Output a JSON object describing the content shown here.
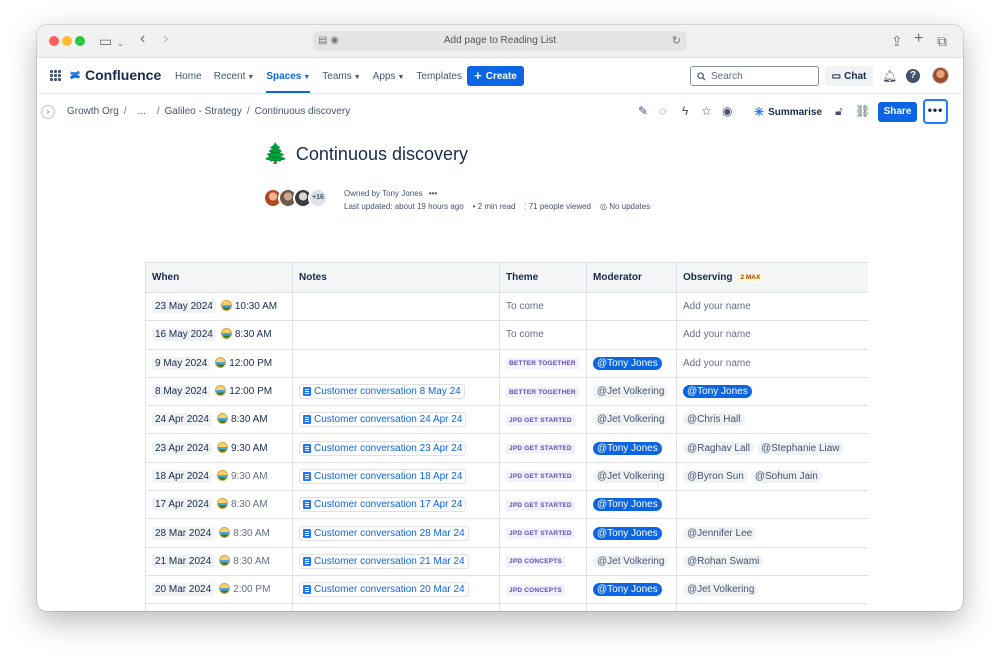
{
  "browser": {
    "address_text": "Add page to Reading List"
  },
  "header": {
    "product_name": "Confluence",
    "nav": [
      {
        "label": "Home",
        "dropdown": false
      },
      {
        "label": "Recent",
        "dropdown": true
      },
      {
        "label": "Spaces",
        "dropdown": true,
        "active": true
      },
      {
        "label": "Teams",
        "dropdown": true
      },
      {
        "label": "Apps",
        "dropdown": true
      },
      {
        "label": "Templates",
        "dropdown": false
      }
    ],
    "create_label": "Create",
    "search_placeholder": "Search",
    "chat_label": "Chat",
    "help_glyph": "?"
  },
  "pagebar": {
    "breadcrumbs": [
      "Growth Org",
      "...",
      "Galileo - Strategy",
      "Continuous discovery"
    ],
    "summarise_label": "Summarise",
    "share_label": "Share",
    "more_glyph": "•••"
  },
  "page": {
    "emoji": "🌲",
    "title": "Continuous discovery",
    "contributors_more": "+16",
    "owned_by": "Owned by Tony Jones",
    "last_updated": "Last updated: about 19 hours ago",
    "read_time": "2 min read",
    "views": "71 people viewed",
    "updates": "No updates"
  },
  "table": {
    "headers": {
      "when": "When",
      "notes": "Notes",
      "theme": "Theme",
      "moderator": "Moderator",
      "observing": "Observing",
      "observing_badge": "2 MAX"
    },
    "rows": [
      {
        "date": "23 May 2024",
        "time": "10:30 AM",
        "time_dim": false,
        "note": "",
        "theme": "To come",
        "theme_type": "text",
        "moderator": "",
        "moderator_me": false,
        "observers": [],
        "observer_placeholder": "Add your name"
      },
      {
        "date": "16 May 2024",
        "time": "8:30 AM",
        "time_dim": false,
        "note": "",
        "theme": "To come",
        "theme_type": "text",
        "moderator": "",
        "moderator_me": false,
        "observers": [],
        "observer_placeholder": "Add your name"
      },
      {
        "date": "9 May 2024",
        "time": "12:00 PM",
        "time_dim": false,
        "note": "",
        "theme": "BETTER TOGETHER",
        "theme_type": "lozenge",
        "moderator": "@Tony Jones",
        "moderator_me": true,
        "observers": [],
        "observer_placeholder": "Add your name"
      },
      {
        "date": "8 May 2024",
        "time": "12:00 PM",
        "time_dim": false,
        "note": "Customer conversation 8 May 24",
        "theme": "BETTER TOGETHER",
        "theme_type": "lozenge",
        "moderator": "@Jet Volkering",
        "moderator_me": false,
        "observers": [
          {
            "name": "@Tony Jones",
            "me": true
          }
        ],
        "observer_placeholder": ""
      },
      {
        "date": "24 Apr 2024",
        "time": "8:30 AM",
        "time_dim": false,
        "note": "Customer conversation 24 Apr 24",
        "theme": "JPD GET STARTED",
        "theme_type": "lozenge",
        "moderator": "@Jet Volkering",
        "moderator_me": false,
        "observers": [
          {
            "name": "@Chris Hall",
            "me": false
          }
        ],
        "observer_placeholder": ""
      },
      {
        "date": "23 Apr 2024",
        "time": "9:30 AM",
        "time_dim": false,
        "note": "Customer conversation 23 Apr 24",
        "theme": "JPD GET STARTED",
        "theme_type": "lozenge",
        "moderator": "@Tony Jones",
        "moderator_me": true,
        "observers": [
          {
            "name": "@Raghav Lall",
            "me": false
          },
          {
            "name": "@Stephanie Liaw",
            "me": false
          }
        ],
        "observer_placeholder": ""
      },
      {
        "date": "18 Apr 2024",
        "time": "9:30 AM",
        "time_dim": true,
        "note": "Customer conversation 18 Apr 24",
        "theme": "JPD GET STARTED",
        "theme_type": "lozenge",
        "moderator": "@Jet Volkering",
        "moderator_me": false,
        "observers": [
          {
            "name": "@Byron Sun",
            "me": false
          },
          {
            "name": "@Sohum Jain",
            "me": false
          }
        ],
        "observer_placeholder": ""
      },
      {
        "date": "17 Apr 2024",
        "time": "8:30 AM",
        "time_dim": true,
        "note": "Customer conversation 17 Apr 24",
        "theme": "JPD GET STARTED",
        "theme_type": "lozenge",
        "moderator": "@Tony Jones",
        "moderator_me": true,
        "observers": [],
        "observer_placeholder": ""
      },
      {
        "date": "28 Mar 2024",
        "time": "8:30 AM",
        "time_dim": true,
        "note": "Customer conversation 28 Mar 24",
        "theme": "JPD GET STARTED",
        "theme_type": "lozenge",
        "moderator": "@Tony Jones",
        "moderator_me": true,
        "observers": [
          {
            "name": "@Jennifer Lee",
            "me": false
          }
        ],
        "observer_placeholder": ""
      },
      {
        "date": "21 Mar 2024",
        "time": "8:30 AM",
        "time_dim": true,
        "note": "Customer conversation 21 Mar 24",
        "theme": "JPD CONCEPTS",
        "theme_type": "lozenge",
        "moderator": "@Jet Volkering",
        "moderator_me": false,
        "observers": [
          {
            "name": "@Rohan Swami",
            "me": false
          }
        ],
        "observer_placeholder": ""
      },
      {
        "date": "20 Mar 2024",
        "time": "2:00 PM",
        "time_dim": true,
        "note": "Customer conversation 20 Mar 24",
        "theme": "JPD CONCEPTS",
        "theme_type": "lozenge",
        "moderator": "@Tony Jones",
        "moderator_me": true,
        "observers": [
          {
            "name": "@Jet Volkering",
            "me": false
          }
        ],
        "observer_placeholder": ""
      },
      {
        "date": "",
        "time": "",
        "time_dim": false,
        "note": "",
        "theme": "",
        "theme_type": "text",
        "moderator": "",
        "moderator_me": false,
        "observers": [],
        "observer_placeholder": ""
      }
    ]
  },
  "colors": {
    "brand": "#0c66e4",
    "mention_self_bg": "#0c66e4",
    "lozenge_bg": "#f3f0ff",
    "lozenge_text": "#5e4db2",
    "max_badge_bg": "#fff7d6"
  },
  "icons": {
    "safari": [
      "sidebar-icon",
      "back-icon",
      "forward-icon",
      "share-icon",
      "new-tab-icon",
      "tabs-icon",
      "reader-icon",
      "reload-icon"
    ],
    "header": [
      "app-switcher-icon",
      "confluence-logo-icon",
      "plus-icon",
      "search-icon",
      "chat-icon",
      "notifications-icon",
      "help-icon",
      "avatar"
    ],
    "pagebar": [
      "edit-icon",
      "comment-icon",
      "automation-icon",
      "star-icon",
      "watch-icon",
      "summarise-icon",
      "restrictions-icon",
      "link-icon"
    ]
  }
}
